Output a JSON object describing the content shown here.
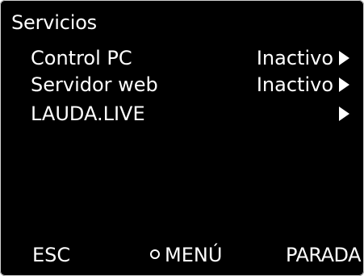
{
  "screen": {
    "title": "Servicios",
    "menu_items": [
      {
        "label": "Control PC",
        "value": "Inactivo",
        "icon": "chevron-right-icon"
      },
      {
        "label": "Servidor web",
        "value": "Inactivo",
        "icon": "chevron-right-icon"
      },
      {
        "label": "LAUDA.LIVE",
        "value": "",
        "icon": "chevron-right-icon"
      }
    ]
  },
  "softkeys": {
    "left": "ESC",
    "middle": "MENÚ",
    "middle_icon": "circle-icon",
    "right": "PARADA"
  },
  "colors": {
    "background": "#000000",
    "text": "#ffffff"
  }
}
